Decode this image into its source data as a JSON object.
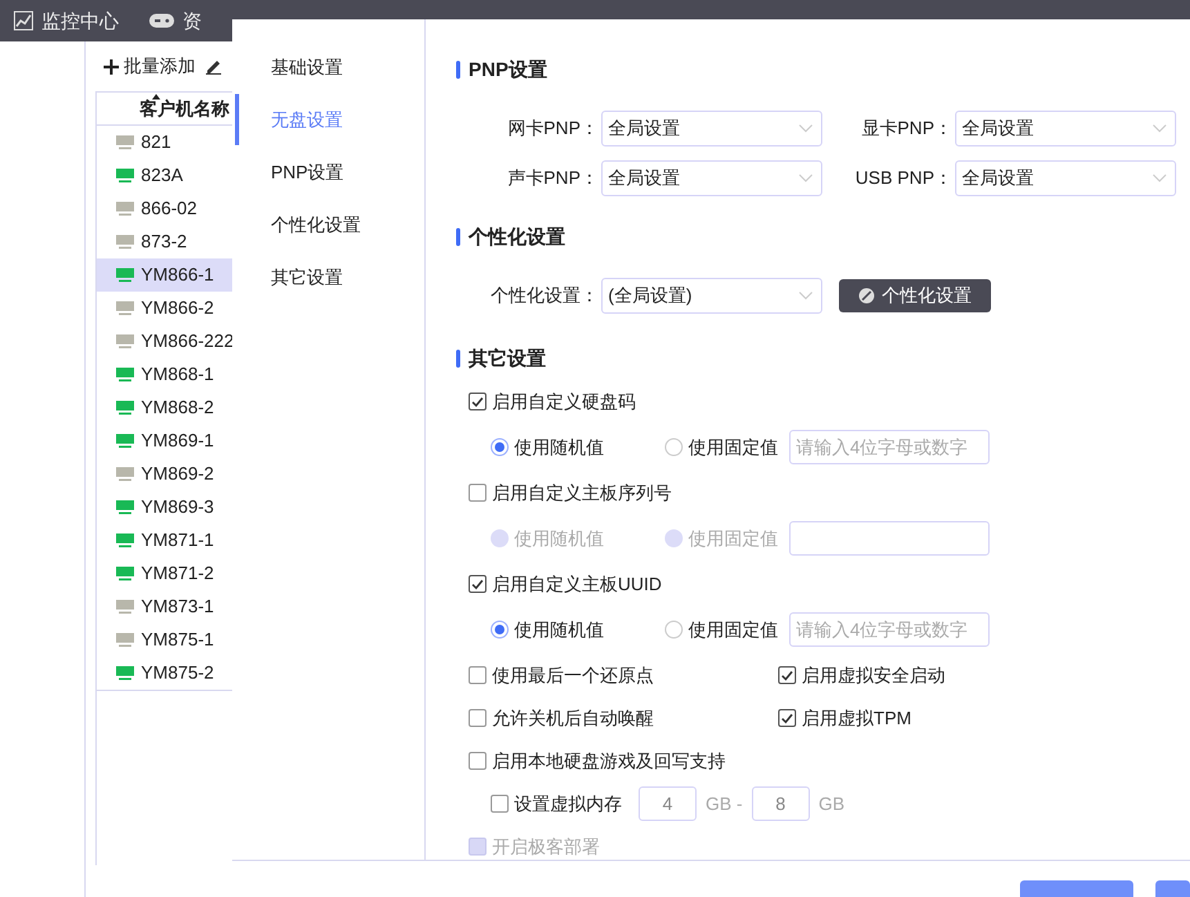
{
  "topbar": {
    "tabs": [
      {
        "label": "监控中心"
      },
      {
        "label": "资"
      }
    ]
  },
  "toolbar": {
    "add_button": "批量添加"
  },
  "client_table": {
    "column": "客户机名称",
    "rows": [
      {
        "name": "821",
        "online": false,
        "selected": false
      },
      {
        "name": "823A",
        "online": true,
        "selected": false
      },
      {
        "name": "866-02",
        "online": false,
        "selected": false
      },
      {
        "name": "873-2",
        "online": false,
        "selected": false
      },
      {
        "name": "YM866-1",
        "online": true,
        "selected": true
      },
      {
        "name": "YM866-2",
        "online": false,
        "selected": false
      },
      {
        "name": "YM866-222",
        "online": false,
        "selected": false
      },
      {
        "name": "YM868-1",
        "online": true,
        "selected": false
      },
      {
        "name": "YM868-2",
        "online": true,
        "selected": false
      },
      {
        "name": "YM869-1",
        "online": true,
        "selected": false
      },
      {
        "name": "YM869-2",
        "online": false,
        "selected": false
      },
      {
        "name": "YM869-3",
        "online": true,
        "selected": false
      },
      {
        "name": "YM871-1",
        "online": true,
        "selected": false
      },
      {
        "name": "YM871-2",
        "online": true,
        "selected": false
      },
      {
        "name": "YM873-1",
        "online": false,
        "selected": false
      },
      {
        "name": "YM875-1",
        "online": false,
        "selected": false
      },
      {
        "name": "YM875-2",
        "online": true,
        "selected": false
      }
    ]
  },
  "dialog": {
    "nav": [
      {
        "label": "基础设置",
        "selected": false
      },
      {
        "label": "无盘设置",
        "selected": true
      },
      {
        "label": "PNP设置",
        "selected": false
      },
      {
        "label": "个性化设置",
        "selected": false
      },
      {
        "label": "其它设置",
        "selected": false
      }
    ],
    "pnp": {
      "title": "PNP设置",
      "fields": [
        {
          "label": "网卡PNP：",
          "value": "全局设置"
        },
        {
          "label": "显卡PNP：",
          "value": "全局设置"
        },
        {
          "label": "声卡PNP：",
          "value": "全局设置"
        },
        {
          "label": "USB PNP：",
          "value": "全局设置"
        }
      ]
    },
    "personalization": {
      "title": "个性化设置",
      "label": "个性化设置：",
      "value": "(全局设置)",
      "button": "个性化设置"
    },
    "other": {
      "title": "其它设置",
      "items": [
        {
          "kind": "checkbox",
          "label": "启用自定义硬盘码",
          "checked": true,
          "disabled": false
        },
        {
          "kind": "radio",
          "disabled": false,
          "options": [
            {
              "label": "使用随机值",
              "selected": true
            },
            {
              "label": "使用固定值",
              "selected": false
            }
          ],
          "placeholder": "请输入4位字母或数字"
        },
        {
          "kind": "checkbox",
          "label": "启用自定义主板序列号",
          "checked": false,
          "disabled": false
        },
        {
          "kind": "radio",
          "disabled": true,
          "options": [
            {
              "label": "使用随机值",
              "selected": false
            },
            {
              "label": "使用固定值",
              "selected": false
            }
          ]
        },
        {
          "kind": "checkbox",
          "label": "启用自定义主板UUID",
          "checked": true,
          "disabled": false
        },
        {
          "kind": "radio",
          "disabled": false,
          "options": [
            {
              "label": "使用随机值",
              "selected": true
            },
            {
              "label": "使用固定值",
              "selected": false
            }
          ],
          "placeholder": "请输入4位字母或数字"
        },
        {
          "kind": "pair",
          "checks": [
            {
              "label": "使用最后一个还原点",
              "checked": false
            },
            {
              "label": "启用虚拟安全启动",
              "checked": true
            }
          ]
        },
        {
          "kind": "pair",
          "checks": [
            {
              "label": "允许关机后自动唤醒",
              "checked": false
            },
            {
              "label": "启用虚拟TPM",
              "checked": true
            }
          ]
        },
        {
          "kind": "checkbox",
          "label": "启用本地硬盘游戏及回写支持",
          "checked": false,
          "disabled": false
        },
        {
          "kind": "memory",
          "label": "设置虚拟内存",
          "checked": false,
          "from": "4",
          "from_unit": "GB -",
          "to": "8",
          "to_unit": "GB"
        },
        {
          "kind": "checkbox",
          "label": "开启极客部署",
          "checked": false,
          "disabled": true
        }
      ]
    }
  }
}
